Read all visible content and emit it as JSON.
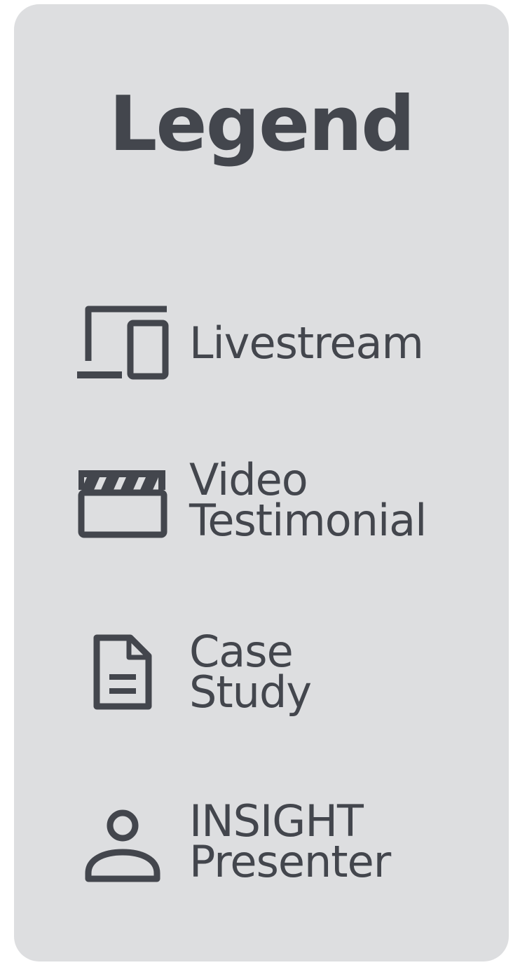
{
  "legend": {
    "title": "Legend",
    "items": [
      {
        "icon": "devices-icon",
        "lines": [
          "Livestream"
        ]
      },
      {
        "icon": "clapperboard-icon",
        "lines": [
          "Video",
          "Testimonial"
        ]
      },
      {
        "icon": "document-icon",
        "lines": [
          "Case",
          "Study"
        ]
      },
      {
        "icon": "person-icon",
        "lines": [
          "INSIGHT",
          "Presenter"
        ]
      }
    ]
  },
  "colors": {
    "background": "#ffffff",
    "card": "#dddee0",
    "text": "#43464d"
  }
}
